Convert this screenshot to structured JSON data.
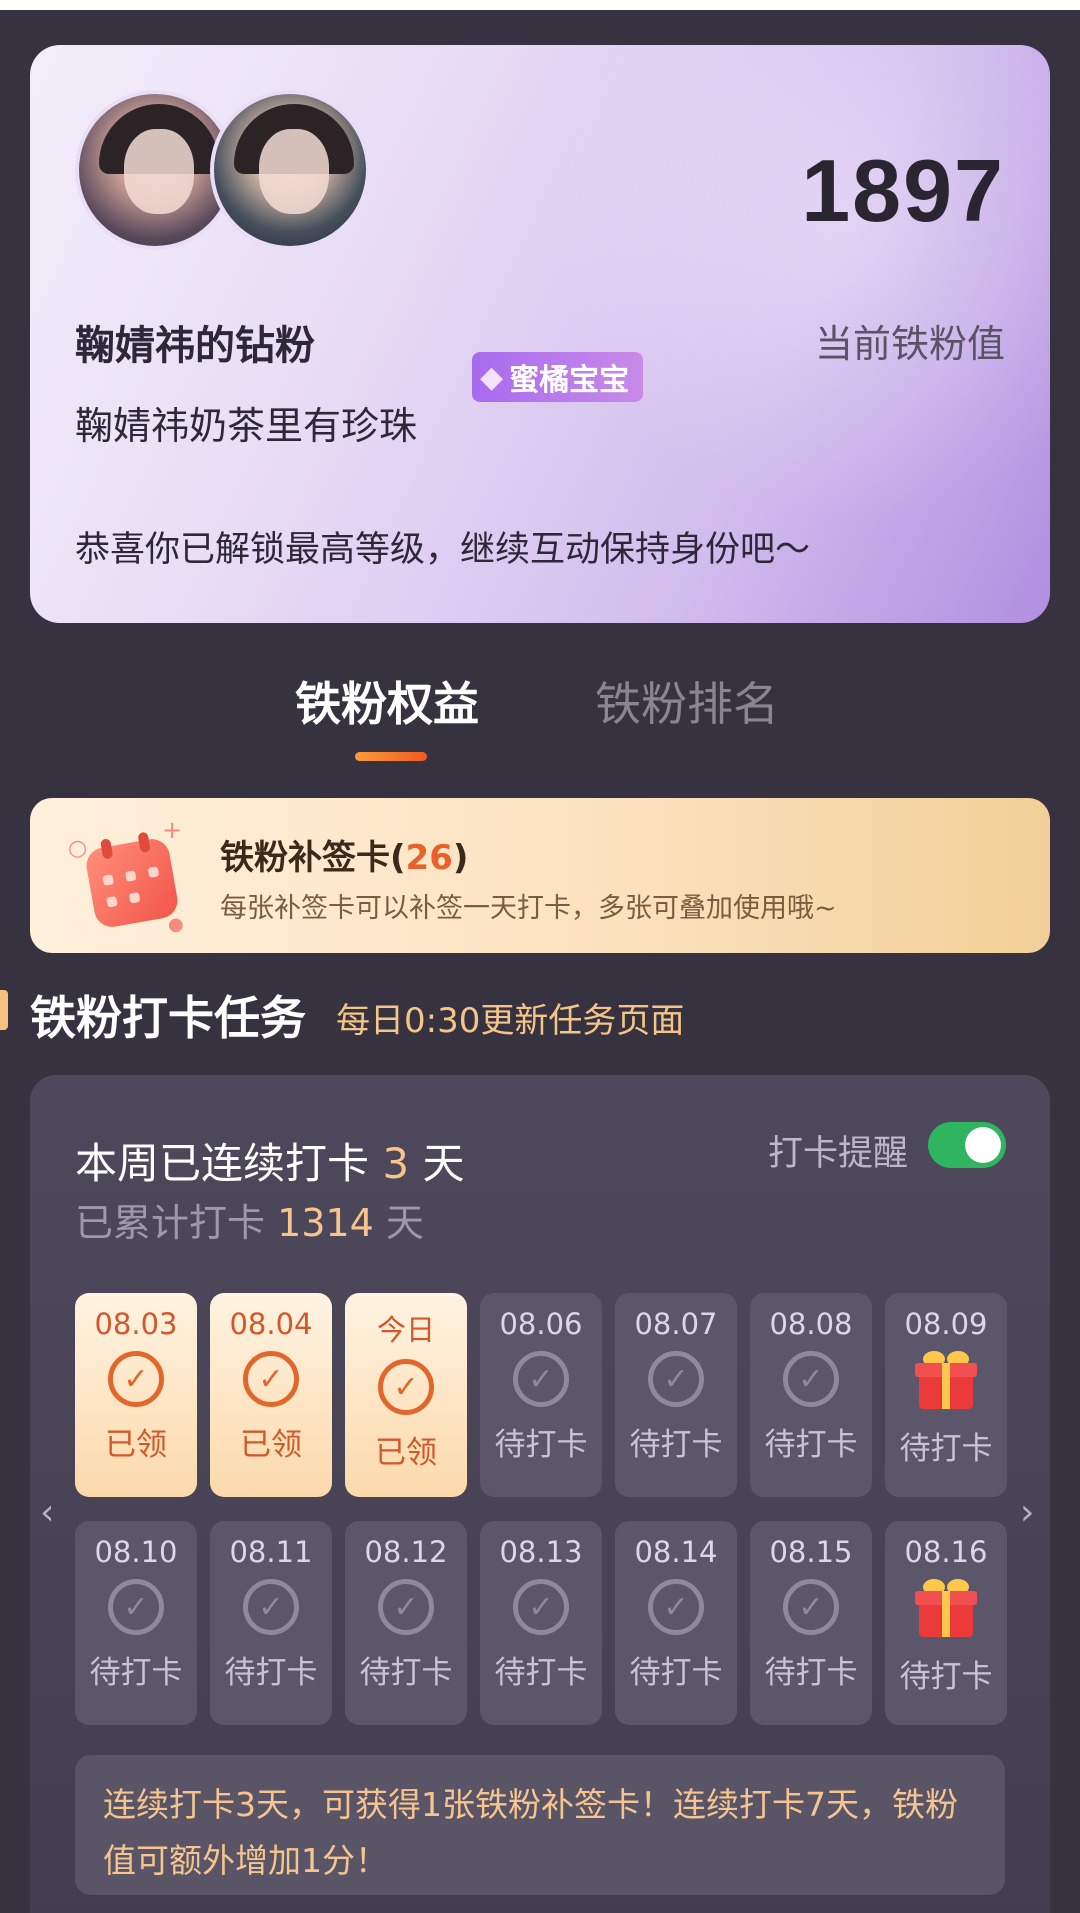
{
  "profile": {
    "title": "鞠婧祎的钻粉",
    "subtitle": "鞠婧祎奶茶里有珍珠",
    "badge_label": "蜜橘宝宝",
    "score": "1897",
    "score_label": "当前铁粉值",
    "message": "恭喜你已解锁最高等级，继续互动保持身份吧～"
  },
  "tabs": [
    {
      "label": "铁粉权益",
      "active": true
    },
    {
      "label": "铁粉排名",
      "active": false
    }
  ],
  "card_banner": {
    "title": "铁粉补签卡",
    "count": "26",
    "description": "每张补签卡可以补签一天打卡，多张可叠加使用哦~"
  },
  "section": {
    "title": "铁粉打卡任务",
    "note": "每日0:30更新任务页面"
  },
  "checkin": {
    "streak_prefix": "本周已连续打卡",
    "streak_days": "3",
    "streak_unit": "天",
    "total_prefix": "已累计打卡",
    "total_days": "1314",
    "total_unit": "天",
    "reminder_label": "打卡提醒",
    "reminder_on": true,
    "days": [
      {
        "date": "08.03",
        "status": "已领",
        "done": true,
        "gift": false
      },
      {
        "date": "08.04",
        "status": "已领",
        "done": true,
        "gift": false
      },
      {
        "date": "今日",
        "status": "已领",
        "done": true,
        "gift": false
      },
      {
        "date": "08.06",
        "status": "待打卡",
        "done": false,
        "gift": false
      },
      {
        "date": "08.07",
        "status": "待打卡",
        "done": false,
        "gift": false
      },
      {
        "date": "08.08",
        "status": "待打卡",
        "done": false,
        "gift": false
      },
      {
        "date": "08.09",
        "status": "待打卡",
        "done": false,
        "gift": true
      },
      {
        "date": "08.10",
        "status": "待打卡",
        "done": false,
        "gift": false
      },
      {
        "date": "08.11",
        "status": "待打卡",
        "done": false,
        "gift": false
      },
      {
        "date": "08.12",
        "status": "待打卡",
        "done": false,
        "gift": false
      },
      {
        "date": "08.13",
        "status": "待打卡",
        "done": false,
        "gift": false
      },
      {
        "date": "08.14",
        "status": "待打卡",
        "done": false,
        "gift": false
      },
      {
        "date": "08.15",
        "status": "待打卡",
        "done": false,
        "gift": false
      },
      {
        "date": "08.16",
        "status": "待打卡",
        "done": false,
        "gift": true
      }
    ],
    "note": "连续打卡3天，可获得1张铁粉补签卡！连续打卡7天，铁粉值可额外增加1分！"
  },
  "icons": {
    "prev": "chevron-left-icon",
    "next": "chevron-right-icon",
    "check": "check-circle-icon",
    "gift": "gift-icon",
    "calendar": "calendar-icon",
    "diamond": "diamond-icon"
  },
  "colors": {
    "background": "#36323f",
    "accent_orange": "#e8612b",
    "highlight": "#f7c48a",
    "toggle_on": "#2fb55f"
  }
}
